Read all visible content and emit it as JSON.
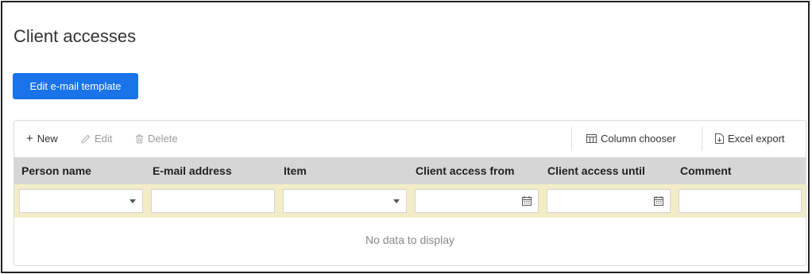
{
  "page": {
    "title": "Client accesses",
    "edit_template_label": "Edit e-mail template"
  },
  "toolbar": {
    "new_label": "New",
    "edit_label": "Edit",
    "delete_label": "Delete",
    "column_chooser_label": "Column chooser",
    "excel_export_label": "Excel export"
  },
  "columns": [
    "Person name",
    "E-mail address",
    "Item",
    "Client access from",
    "Client access until",
    "Comment"
  ],
  "empty_message": "No data to display",
  "colors": {
    "primary": "#1a73e8",
    "header_bg": "#d6d6d6",
    "filter_bg": "#f2edc6"
  }
}
